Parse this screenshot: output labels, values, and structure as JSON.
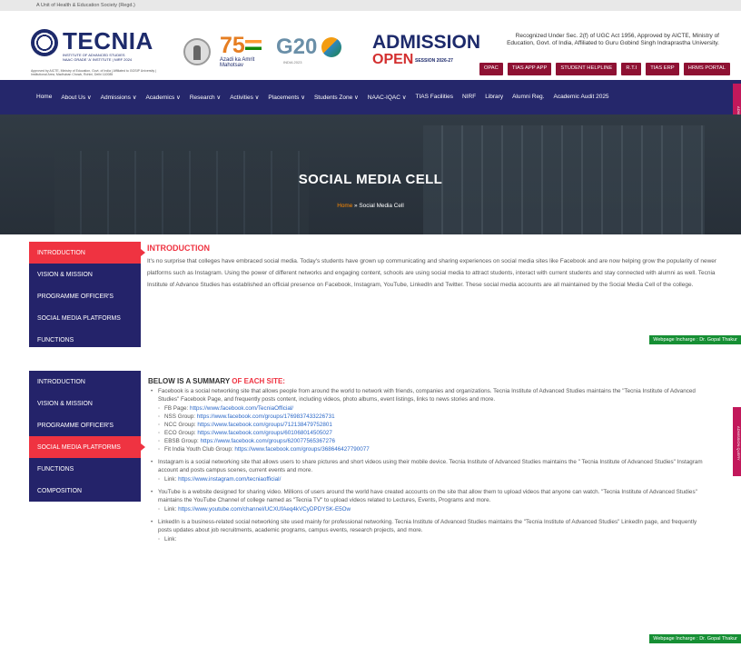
{
  "top_strip": "A Unit of Health & Education Society (Regd.)",
  "logo": {
    "title": "TECNIA",
    "sub": "INSTITUTE OF ADVANCED STUDIES",
    "sub2": "NAAC GRADE 'A' INSTITUTE | NIRF 2024",
    "address": "Approved by AICTE, Ministry of Education, Govt. of India | Affiliated to GGSIP University | Institutional Area, Madhuban Chowk, Rohini, Delhi 110085"
  },
  "partners": {
    "azadi": "Azadi ka Amrit Mahotsav",
    "g20": "G20",
    "g20_sub": "INDIA 2023"
  },
  "admission": {
    "title": "ADMISSION",
    "open": "OPEN",
    "session": "SESSION 2026-27"
  },
  "recognition": "Recognized Under Sec. 2(f) of UGC Act 1956, Approved by AICTE, Ministry of Education, Govt. of India, Affiliated to Guru Gobind Singh Indraprastha University.",
  "quick_links": [
    "OPAC",
    "TIAS APP APP",
    "STUDENT HELPLINE",
    "R.T.I",
    "TIAS ERP",
    "HRMS PORTAL"
  ],
  "nav_items": [
    "Home",
    "About Us ∨",
    "Admissions ∨",
    "Academics ∨",
    "Research ∨",
    "Activities ∨",
    "Placements ∨",
    "Students Zone ∨",
    "NAAC-IQAC ∨",
    "TIAS Facilities",
    "NIRF",
    "Library",
    "Alumni Reg.",
    "Academic Audit 2025"
  ],
  "admission_query": "ADMISSION QUERY",
  "hero": {
    "title": "SOCIAL MEDIA CELL",
    "crumb_home": "Home",
    "crumb_separator": " » ",
    "crumb_current": "Social Media Cell"
  },
  "sidebar_1": [
    {
      "label": "INTRODUCTION",
      "active": true
    },
    {
      "label": "VISION & MISSION",
      "active": false
    },
    {
      "label": "PROGRAMME OFFICER'S",
      "active": false
    },
    {
      "label": "SOCIAL MEDIA PLATFORMS",
      "active": false
    },
    {
      "label": "FUNCTIONS",
      "active": false
    }
  ],
  "intro": {
    "heading": "INTRODUCTION",
    "text": "It's no surprise that colleges have embraced social media. Today's students have grown up communicating and sharing experiences on social media sites like Facebook and are now helping grow the popularity of newer platforms such as Instagram. Using the power of different networks and engaging content, schools are using social media to attract students, interact with current students and stay connected with alumni as well. Tecnia Institute of Advance Studies has established an official presence on Facebook, Instagram, YouTube, LinkedIn and Twitter. These social media accounts are all maintained by the Social Media Cell of the college."
  },
  "incharge": "Webpage Incharge : Dr. Gopal Thakur",
  "sidebar_2": [
    {
      "label": "INTRODUCTION",
      "active": false
    },
    {
      "label": "VISION & MISSION",
      "active": false
    },
    {
      "label": "PROGRAMME OFFICER'S",
      "active": false
    },
    {
      "label": "SOCIAL MEDIA PLATFORMS",
      "active": true
    },
    {
      "label": "FUNCTIONS",
      "active": false
    },
    {
      "label": "COMPOSITION",
      "active": false
    }
  ],
  "summary": {
    "heading_plain": "BELOW IS A SUMMARY ",
    "heading_red": "OF EACH SITE:",
    "facebook": "Facebook is a social networking site that allows people from around the world to network with friends, companies and organizations. Tecnia Institute of Advanced Studies maintains the \"Tecnia Institute of Advanced Studies\" Facebook Page, and frequently posts content, including videos, photo albums, event listings, links to news stories and more.",
    "facebook_links": [
      {
        "label": "FB Page: ",
        "url": "https://www.facebook.com/TecniaOfficial/"
      },
      {
        "label": "NSS Group: ",
        "url": "https://www.facebook.com/groups/1769837433226731"
      },
      {
        "label": "NCC Group: ",
        "url": "https://www.facebook.com/groups/712138479752801"
      },
      {
        "label": "ECO Group: ",
        "url": "https://www.facebook.com/groups/601068014505027"
      },
      {
        "label": "EBSB Group: ",
        "url": "https://www.facebook.com/groups/620077565367276"
      },
      {
        "label": "Fit India Youth Club Group: ",
        "url": "https://www.facebook.com/groups/368646427790077"
      }
    ],
    "instagram": "Instagram is a social networking site that allows users to share pictures and short videos using their mobile device. Tecnia Institute of Advanced Studies maintains the \" Tecnia Institute of Advanced Studies\" Instagram account and posts campus scenes, current events and more.",
    "instagram_label": "Link: ",
    "instagram_link": "https://www.instagram.com/tecniaofficial/",
    "youtube": "YouTube is a website designed for sharing video. Millions of users around the world have created accounts on the site that allow them to upload videos that anyone can watch. \"Tecnia Institute of Advanced Studies\" maintains the YouTube Channel of college named as \"Tecnia TV\" to upload videos related to Lectures, Events, Programs and more.",
    "youtube_label": "Link: ",
    "youtube_link": "https://www.youtube.com/channel/UCXUfAeq4kVCyDPDYSK-E5Ow",
    "linkedin": "LinkedIn is a business-related social networking site used mainly for professional networking. Tecnia Institute of Advanced Studies maintains the \"Tecnia Institute of Advanced Studies\" LinkedIn page, and frequently posts updates about job recruitments, academic programs, campus events, research projects, and more.",
    "linkedin_label": "Link:"
  }
}
